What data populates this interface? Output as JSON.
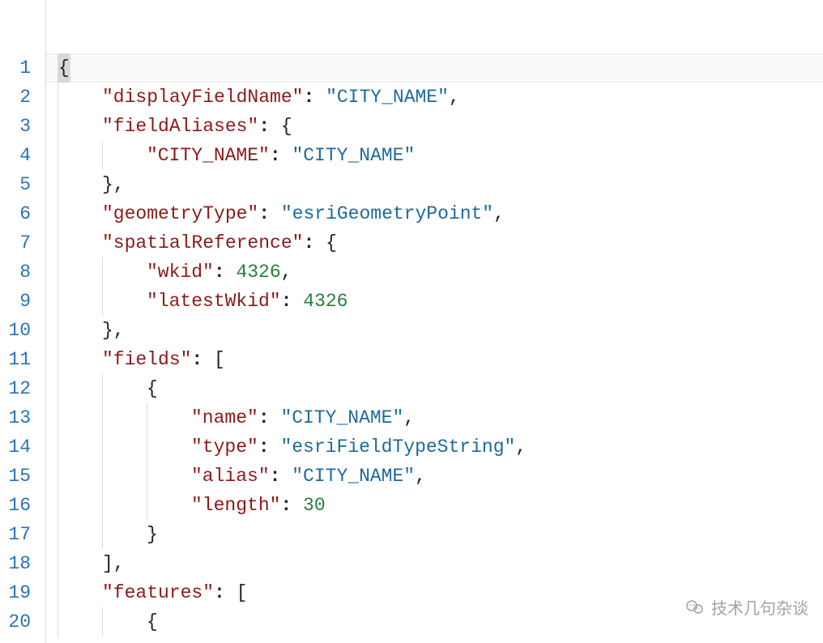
{
  "lines": {
    "l1": {
      "num": "1"
    },
    "l2": {
      "num": "2",
      "key": "\"displayFieldName\"",
      "val": "\"CITY_NAME\""
    },
    "l3": {
      "num": "3",
      "key": "\"fieldAliases\""
    },
    "l4": {
      "num": "4",
      "key": "\"CITY_NAME\"",
      "val": "\"CITY_NAME\""
    },
    "l5": {
      "num": "5"
    },
    "l6": {
      "num": "6",
      "key": "\"geometryType\"",
      "val": "\"esriGeometryPoint\""
    },
    "l7": {
      "num": "7",
      "key": "\"spatialReference\""
    },
    "l8": {
      "num": "8",
      "key": "\"wkid\"",
      "val": "4326"
    },
    "l9": {
      "num": "9",
      "key": "\"latestWkid\"",
      "val": "4326"
    },
    "l10": {
      "num": "10"
    },
    "l11": {
      "num": "11",
      "key": "\"fields\""
    },
    "l12": {
      "num": "12"
    },
    "l13": {
      "num": "13",
      "key": "\"name\"",
      "val": "\"CITY_NAME\""
    },
    "l14": {
      "num": "14",
      "key": "\"type\"",
      "val": "\"esriFieldTypeString\""
    },
    "l15": {
      "num": "15",
      "key": "\"alias\"",
      "val": "\"CITY_NAME\""
    },
    "l16": {
      "num": "16",
      "key": "\"length\"",
      "val": "30"
    },
    "l17": {
      "num": "17"
    },
    "l18": {
      "num": "18"
    },
    "l19": {
      "num": "19",
      "key": "\"features\""
    },
    "l20": {
      "num": "20"
    }
  },
  "tokens": {
    "openBrace": "{",
    "closeBrace": "}",
    "openBracket": "[",
    "closeBracket": "]",
    "colon": ":",
    "comma": ",",
    "closeBraceComma": "},",
    "closeBracketComma": "],"
  },
  "watermark": {
    "text": "技术几句杂谈"
  }
}
